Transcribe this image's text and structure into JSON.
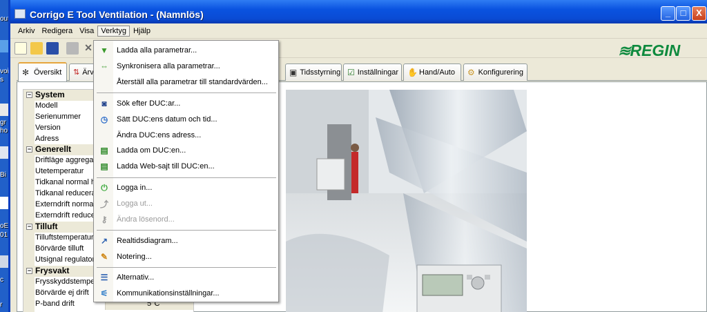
{
  "desktop": {
    "labels": [
      "out",
      "voi",
      "s",
      "gr",
      "ho",
      "Bi",
      "oE",
      "01",
      "c",
      "r"
    ]
  },
  "window": {
    "title": "Corrigo E Tool Ventilation - (Namnlös)",
    "controls": {
      "minimize": "_",
      "maximize": "□",
      "close": "X"
    }
  },
  "menubar": {
    "items": [
      "Arkiv",
      "Redigera",
      "Visa",
      "Verktyg",
      "Hjälp"
    ],
    "active": "Verktyg"
  },
  "logo": {
    "text": "REGIN",
    "color": "#0e8a3e"
  },
  "tabs": [
    {
      "label": "Översikt",
      "icon": "snowflake-icon"
    },
    {
      "label": "Ärv",
      "icon": "arrows-icon"
    },
    {
      "label": "Tidsstyrning",
      "icon": "clock-icon"
    },
    {
      "label": "Inställningar",
      "icon": "checkbox-icon"
    },
    {
      "label": "Hand/Auto",
      "icon": "hand-icon"
    },
    {
      "label": "Konfigurering",
      "icon": "gears-icon"
    }
  ],
  "tree": [
    {
      "type": "group",
      "label": "System",
      "toggle": "−"
    },
    {
      "type": "item",
      "label": "Modell",
      "value": ""
    },
    {
      "type": "item",
      "label": "Serienummer",
      "value": ""
    },
    {
      "type": "item",
      "label": "Version",
      "value": ""
    },
    {
      "type": "item",
      "label": "Adress",
      "value": ""
    },
    {
      "type": "group",
      "label": "Generellt",
      "toggle": "−"
    },
    {
      "type": "item",
      "label": "Driftläge aggregat",
      "value": ""
    },
    {
      "type": "item",
      "label": "Utetemperatur",
      "value": ""
    },
    {
      "type": "item",
      "label": "Tidkanal normal has",
      "value": ""
    },
    {
      "type": "item",
      "label": "Tidkanal reducerad",
      "value": ""
    },
    {
      "type": "item",
      "label": "Externdrift normal ha",
      "value": ""
    },
    {
      "type": "item",
      "label": "Externdrift reducerad",
      "value": ""
    },
    {
      "type": "group",
      "label": "Tilluft",
      "toggle": "−"
    },
    {
      "type": "item",
      "label": "Tilluftstemperatur",
      "value": ""
    },
    {
      "type": "item",
      "label": "Börvärde tilluft",
      "value": ""
    },
    {
      "type": "item",
      "label": "Utsignal regulator",
      "value": ""
    },
    {
      "type": "group",
      "label": "Frysvakt",
      "toggle": "−"
    },
    {
      "type": "item",
      "label": "Frysskyddstemperat",
      "value": ""
    },
    {
      "type": "item",
      "label": "Börvärde ej drift",
      "value": ""
    },
    {
      "type": "item",
      "label": "P-band drift",
      "value": "5°C"
    }
  ],
  "dropdown": {
    "items": [
      {
        "label": "Ladda alla parametrar...",
        "icon": "download-arrow-icon",
        "color": "#3a9a2c",
        "glyph": "▼",
        "disabled": false
      },
      {
        "label": "Synkronisera alla parametrar...",
        "icon": "sync-arrows-icon",
        "color": "#3a9a2c",
        "glyph": "⇔",
        "disabled": false
      },
      {
        "label": "Återställ alla parametrar till standardvärden...",
        "icon": "",
        "color": "",
        "glyph": "",
        "disabled": false,
        "sepAfter": true
      },
      {
        "label": "Sök efter DUC:ar...",
        "icon": "binoculars-icon",
        "color": "#1d3f8a",
        "glyph": "◙",
        "disabled": false
      },
      {
        "label": "Sätt DUC:ens datum och tid...",
        "icon": "clock-icon",
        "color": "#2a6ac8",
        "glyph": "◷",
        "disabled": false
      },
      {
        "label": "Ändra DUC:ens adress...",
        "icon": "",
        "color": "",
        "glyph": "",
        "disabled": false
      },
      {
        "label": "Ladda om DUC:en...",
        "icon": "device-download-icon",
        "color": "#2f8a2a",
        "glyph": "▤",
        "disabled": false
      },
      {
        "label": "Ladda Web-sajt till DUC:en...",
        "icon": "web-download-icon",
        "color": "#2f8a2a",
        "glyph": "▤",
        "disabled": false,
        "sepAfter": true
      },
      {
        "label": "Logga in...",
        "icon": "login-icon",
        "color": "#3aa83a",
        "glyph": "⏻",
        "disabled": false
      },
      {
        "label": "Logga ut...",
        "icon": "logout-icon",
        "color": "#9a9a9a",
        "glyph": "⤴",
        "disabled": true
      },
      {
        "label": "Ändra lösenord...",
        "icon": "key-icon",
        "color": "#9a9a9a",
        "glyph": "⚷",
        "disabled": true,
        "sepAfter": true
      },
      {
        "label": "Realtidsdiagram...",
        "icon": "chart-icon",
        "color": "#2a5fb0",
        "glyph": "↗",
        "disabled": false
      },
      {
        "label": "Notering...",
        "icon": "note-icon",
        "color": "#d08a1c",
        "glyph": "✎",
        "disabled": false,
        "sepAfter": true
      },
      {
        "label": "Alternativ...",
        "icon": "options-icon",
        "color": "#2a5fb0",
        "glyph": "☰",
        "disabled": false
      },
      {
        "label": "Kommunikationsinställningar...",
        "icon": "communication-icon",
        "color": "#2a7ac8",
        "glyph": "⚟",
        "disabled": false
      }
    ]
  }
}
